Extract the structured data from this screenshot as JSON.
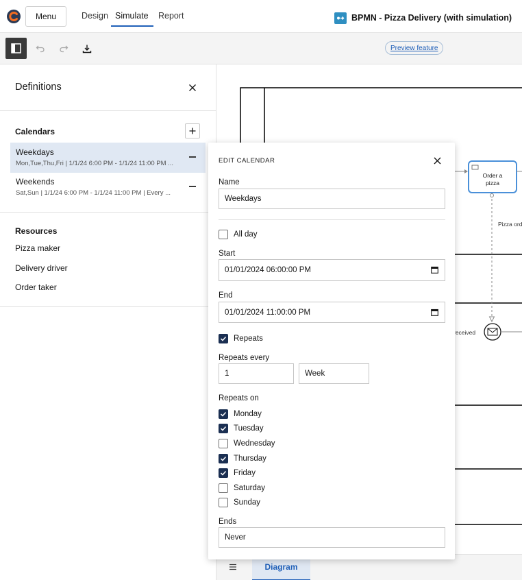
{
  "header": {
    "menu_label": "Menu",
    "tabs": [
      {
        "label": "Design"
      },
      {
        "label": "Simulate"
      },
      {
        "label": "Report"
      }
    ],
    "app_title": "BPMN - Pizza Delivery (with simulation)"
  },
  "toolbar": {
    "preview_label": "Preview feature"
  },
  "sidebar": {
    "title": "Definitions",
    "calendars_title": "Calendars",
    "calendars": [
      {
        "name": "Weekdays",
        "desc": "Mon,Tue,Thu,Fri | 1/1/24 6:00 PM - 1/1/24 11:00 PM ..."
      },
      {
        "name": "Weekends",
        "desc": "Sat,Sun | 1/1/24 6:00 PM - 1/1/24 11:00 PM | Every ..."
      }
    ],
    "resources_title": "Resources",
    "resources": [
      "Pizza maker",
      "Delivery driver",
      "Order taker"
    ]
  },
  "diagram": {
    "task_label_1": "Order a",
    "task_label_2": "pizza",
    "flow_label": "Pizza ord",
    "event_label": "received"
  },
  "bottom": {
    "diagram_tab": "Diagram"
  },
  "modal": {
    "title": "EDIT CALENDAR",
    "name_label": "Name",
    "name_value": "Weekdays",
    "all_day_label": "All day",
    "all_day_checked": false,
    "start_label": "Start",
    "start_value": "01/01/2024 06:00:00 PM",
    "end_label": "End",
    "end_value": "01/01/2024 11:00:00 PM",
    "repeats_label": "Repeats",
    "repeats_checked": true,
    "repeats_every_label": "Repeats every",
    "repeats_every_value": "1",
    "repeats_unit": "Week",
    "repeats_on_label": "Repeats on",
    "days": [
      {
        "label": "Monday",
        "checked": true
      },
      {
        "label": "Tuesday",
        "checked": true
      },
      {
        "label": "Wednesday",
        "checked": false
      },
      {
        "label": "Thursday",
        "checked": true
      },
      {
        "label": "Friday",
        "checked": true
      },
      {
        "label": "Saturday",
        "checked": false
      },
      {
        "label": "Sunday",
        "checked": false
      }
    ],
    "ends_label": "Ends",
    "ends_value": "Never"
  },
  "colors": {
    "accent": "#1f5fb8",
    "checkbox_checked": "#1b2f52",
    "selected_row": "#e0e8f3",
    "task_border": "#4a90d9"
  }
}
